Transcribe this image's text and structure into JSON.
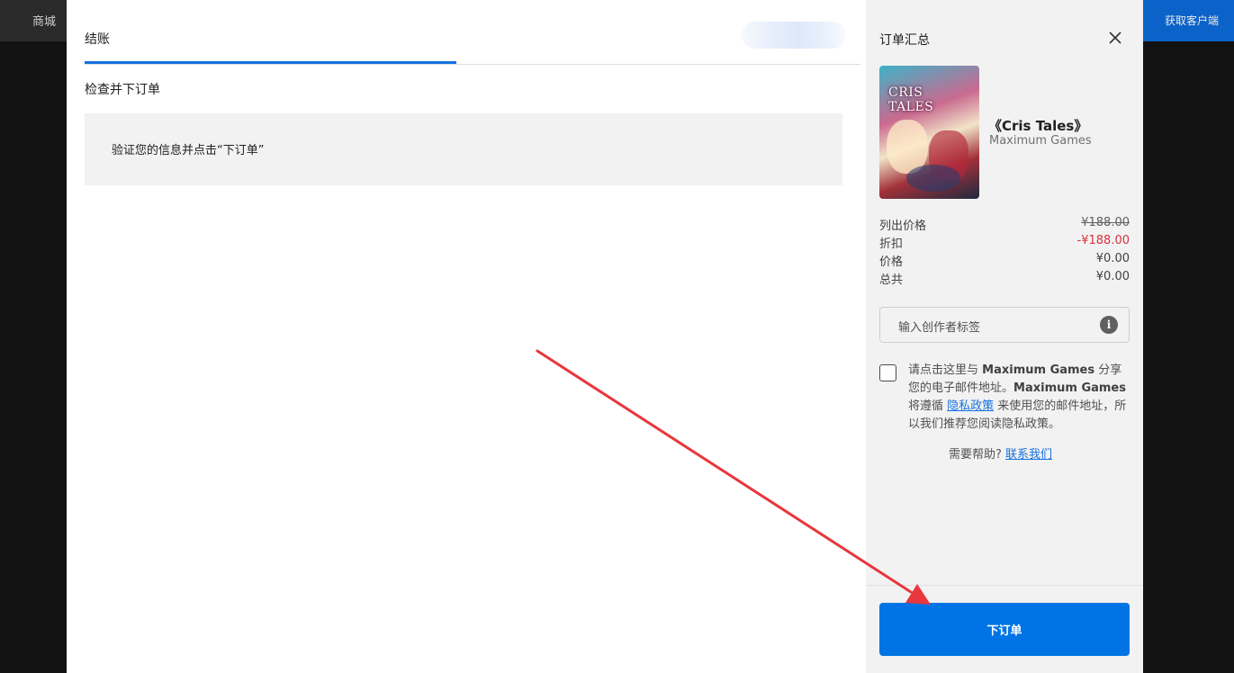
{
  "background": {
    "shop_label": "商城",
    "get_client_label": "获取客户端"
  },
  "checkout": {
    "tab_label": "结账",
    "section_title": "检查并下订单",
    "info_message": "验证您的信息并点击“下订单”"
  },
  "summary": {
    "title": "订单汇总",
    "product": {
      "title": "《Cris Tales》",
      "publisher": "Maximum Games",
      "cover_text": "CRIS TALES"
    },
    "prices": [
      {
        "label": "列出价格",
        "value": "¥188.00"
      },
      {
        "label": "折扣",
        "value": "-¥188.00"
      },
      {
        "label": "价格",
        "value": "¥0.00"
      },
      {
        "label": "总共",
        "value": "¥0.00"
      }
    ],
    "creator_tag_placeholder": "输入创作者标签",
    "info_icon_glyph": "i",
    "consent": {
      "part1": "请点击这里与 ",
      "publisher1": "Maximum Games",
      "part2": " 分享您的电子邮件地址。",
      "publisher2": "Maximum Games",
      "part3": " 将遵循 ",
      "policy_link": "隐私政策",
      "part4": " 来使用您的邮件地址，所以我们推荐您阅读隐私政策。"
    },
    "help": {
      "prompt": "需要帮助? ",
      "link": "联系我们"
    },
    "place_order_label": "下订单"
  },
  "colors": {
    "accent": "#0074e4",
    "tab_underline": "#1572e0",
    "discount": "#d8313b",
    "annotation_arrow": "#e8373d"
  },
  "icons": {
    "close": "close-icon",
    "info": "info-icon",
    "annotation": "annotation-arrow"
  }
}
